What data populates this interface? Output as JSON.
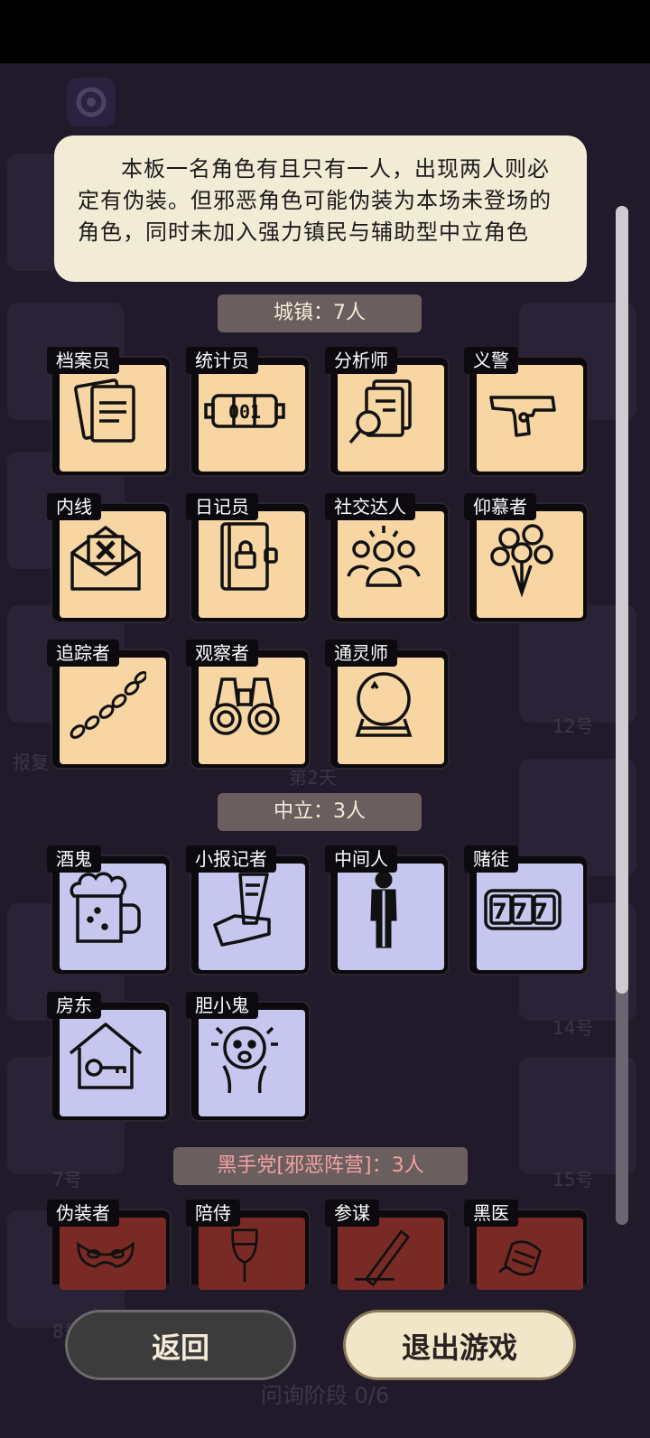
{
  "info": {
    "text": "本板一名角色有且只有一人，出现两人则必定有伪装。但邪恶角色可能伪装为本场未登场的角色，同时未加入强力镇民与辅助型中立角色"
  },
  "sections": {
    "town": "城镇：7人",
    "neutral": "中立：3人",
    "evil": "黑手党[邪恶阵营]：3人"
  },
  "town_roles": [
    "档案员",
    "统计员",
    "分析师",
    "义警",
    "内线",
    "日记员",
    "社交达人",
    "仰慕者",
    "追踪者",
    "观察者",
    "通灵师"
  ],
  "neutral_roles": [
    "酒鬼",
    "小报记者",
    "中间人",
    "赌徒",
    "房东",
    "胆小鬼"
  ],
  "evil_roles": [
    "伪装者",
    "陪侍",
    "参谋",
    "黑医"
  ],
  "icons": {
    "archivist": "documents-icon",
    "statistician": "counter-icon",
    "analyst": "magnifier-docs-icon",
    "vigilante": "pistol-icon",
    "informant": "envelope-x-icon",
    "diarist": "locked-diary-icon",
    "socialite": "crowd-icon",
    "admirer": "bouquet-icon",
    "tracker": "footprints-icon",
    "observer": "binoculars-icon",
    "medium": "crystal-ball-icon",
    "drunk": "beer-mug-icon",
    "tabloid": "newspaper-hand-icon",
    "middleman": "person-icon",
    "gambler": "slot-777-icon",
    "landlord": "house-key-icon",
    "coward": "scared-face-icon",
    "disguiser": "mask-icon",
    "escort": "wine-glass-icon",
    "strategist": "pen-icon",
    "black_doctor": "bandage-icon"
  },
  "gambler_digits": "777",
  "counter_digits": "001",
  "background": {
    "ghost_labels": [
      "7号",
      "8号",
      "12号",
      "14号",
      "15号",
      "第2天",
      "报复"
    ]
  },
  "buttons": {
    "back": "返回",
    "exit": "退出游戏"
  },
  "phase": "问询阶段 0/6",
  "colors": {
    "town_card": "#f7d6a3",
    "neutral_card": "#c7c6ee",
    "evil_card": "#7a2a24",
    "info_bg": "#f2ecd7"
  }
}
